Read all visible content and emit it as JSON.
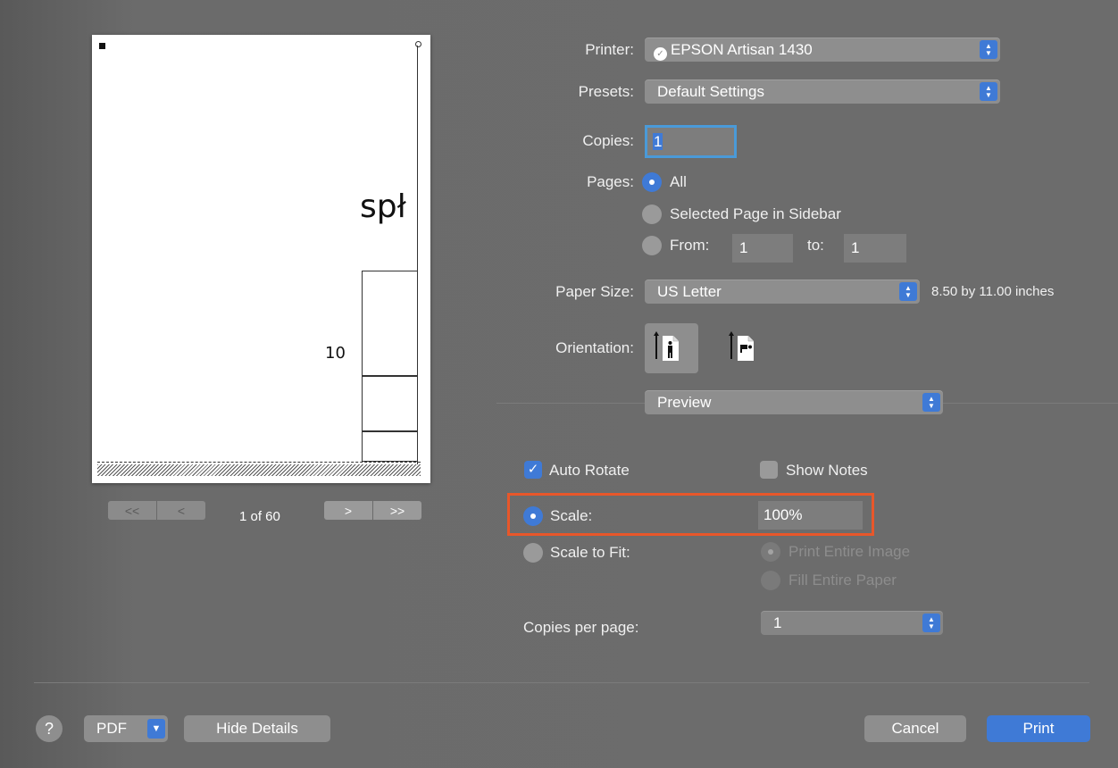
{
  "preview": {
    "snippet_word": "spł",
    "snippet_number": "10",
    "page_indicator": "1 of 60",
    "first_glyph": "<<",
    "prev_glyph": "<",
    "next_glyph": ">",
    "last_glyph": ">>"
  },
  "printer": {
    "label": "Printer:",
    "value": "EPSON Artisan 1430",
    "icon": "printer-sharing-icon"
  },
  "presets": {
    "label": "Presets:",
    "value": "Default Settings"
  },
  "copies": {
    "label": "Copies:",
    "value": "1"
  },
  "pages": {
    "label": "Pages:",
    "all": "All",
    "selected": "Selected Page in Sidebar",
    "from_label": "From:",
    "from_value": "1",
    "to_label": "to:",
    "to_value": "1",
    "selected_option": "All"
  },
  "paper_size": {
    "label": "Paper Size:",
    "value": "US Letter",
    "dimensions": "8.50 by 11.00 inches"
  },
  "orientation": {
    "label": "Orientation:",
    "selected": "portrait"
  },
  "section_popup": {
    "value": "Preview"
  },
  "preview_options": {
    "auto_rotate": {
      "label": "Auto Rotate",
      "checked": true
    },
    "show_notes": {
      "label": "Show Notes",
      "checked": false
    },
    "scale": {
      "label": "Scale:",
      "value": "100%",
      "selected": true
    },
    "scale_to_fit": {
      "label": "Scale to Fit:",
      "selected": false
    },
    "print_entire_image": "Print Entire Image",
    "fill_entire_paper": "Fill Entire Paper",
    "copies_per_page": {
      "label": "Copies per page:",
      "value": "1"
    }
  },
  "footer": {
    "help": "?",
    "pdf": "PDF",
    "hide_details": "Hide Details",
    "cancel": "Cancel",
    "print": "Print"
  },
  "colors": {
    "accent": "#3f7ad6",
    "highlight": "#e8572a",
    "background": "#6a6a6a"
  }
}
